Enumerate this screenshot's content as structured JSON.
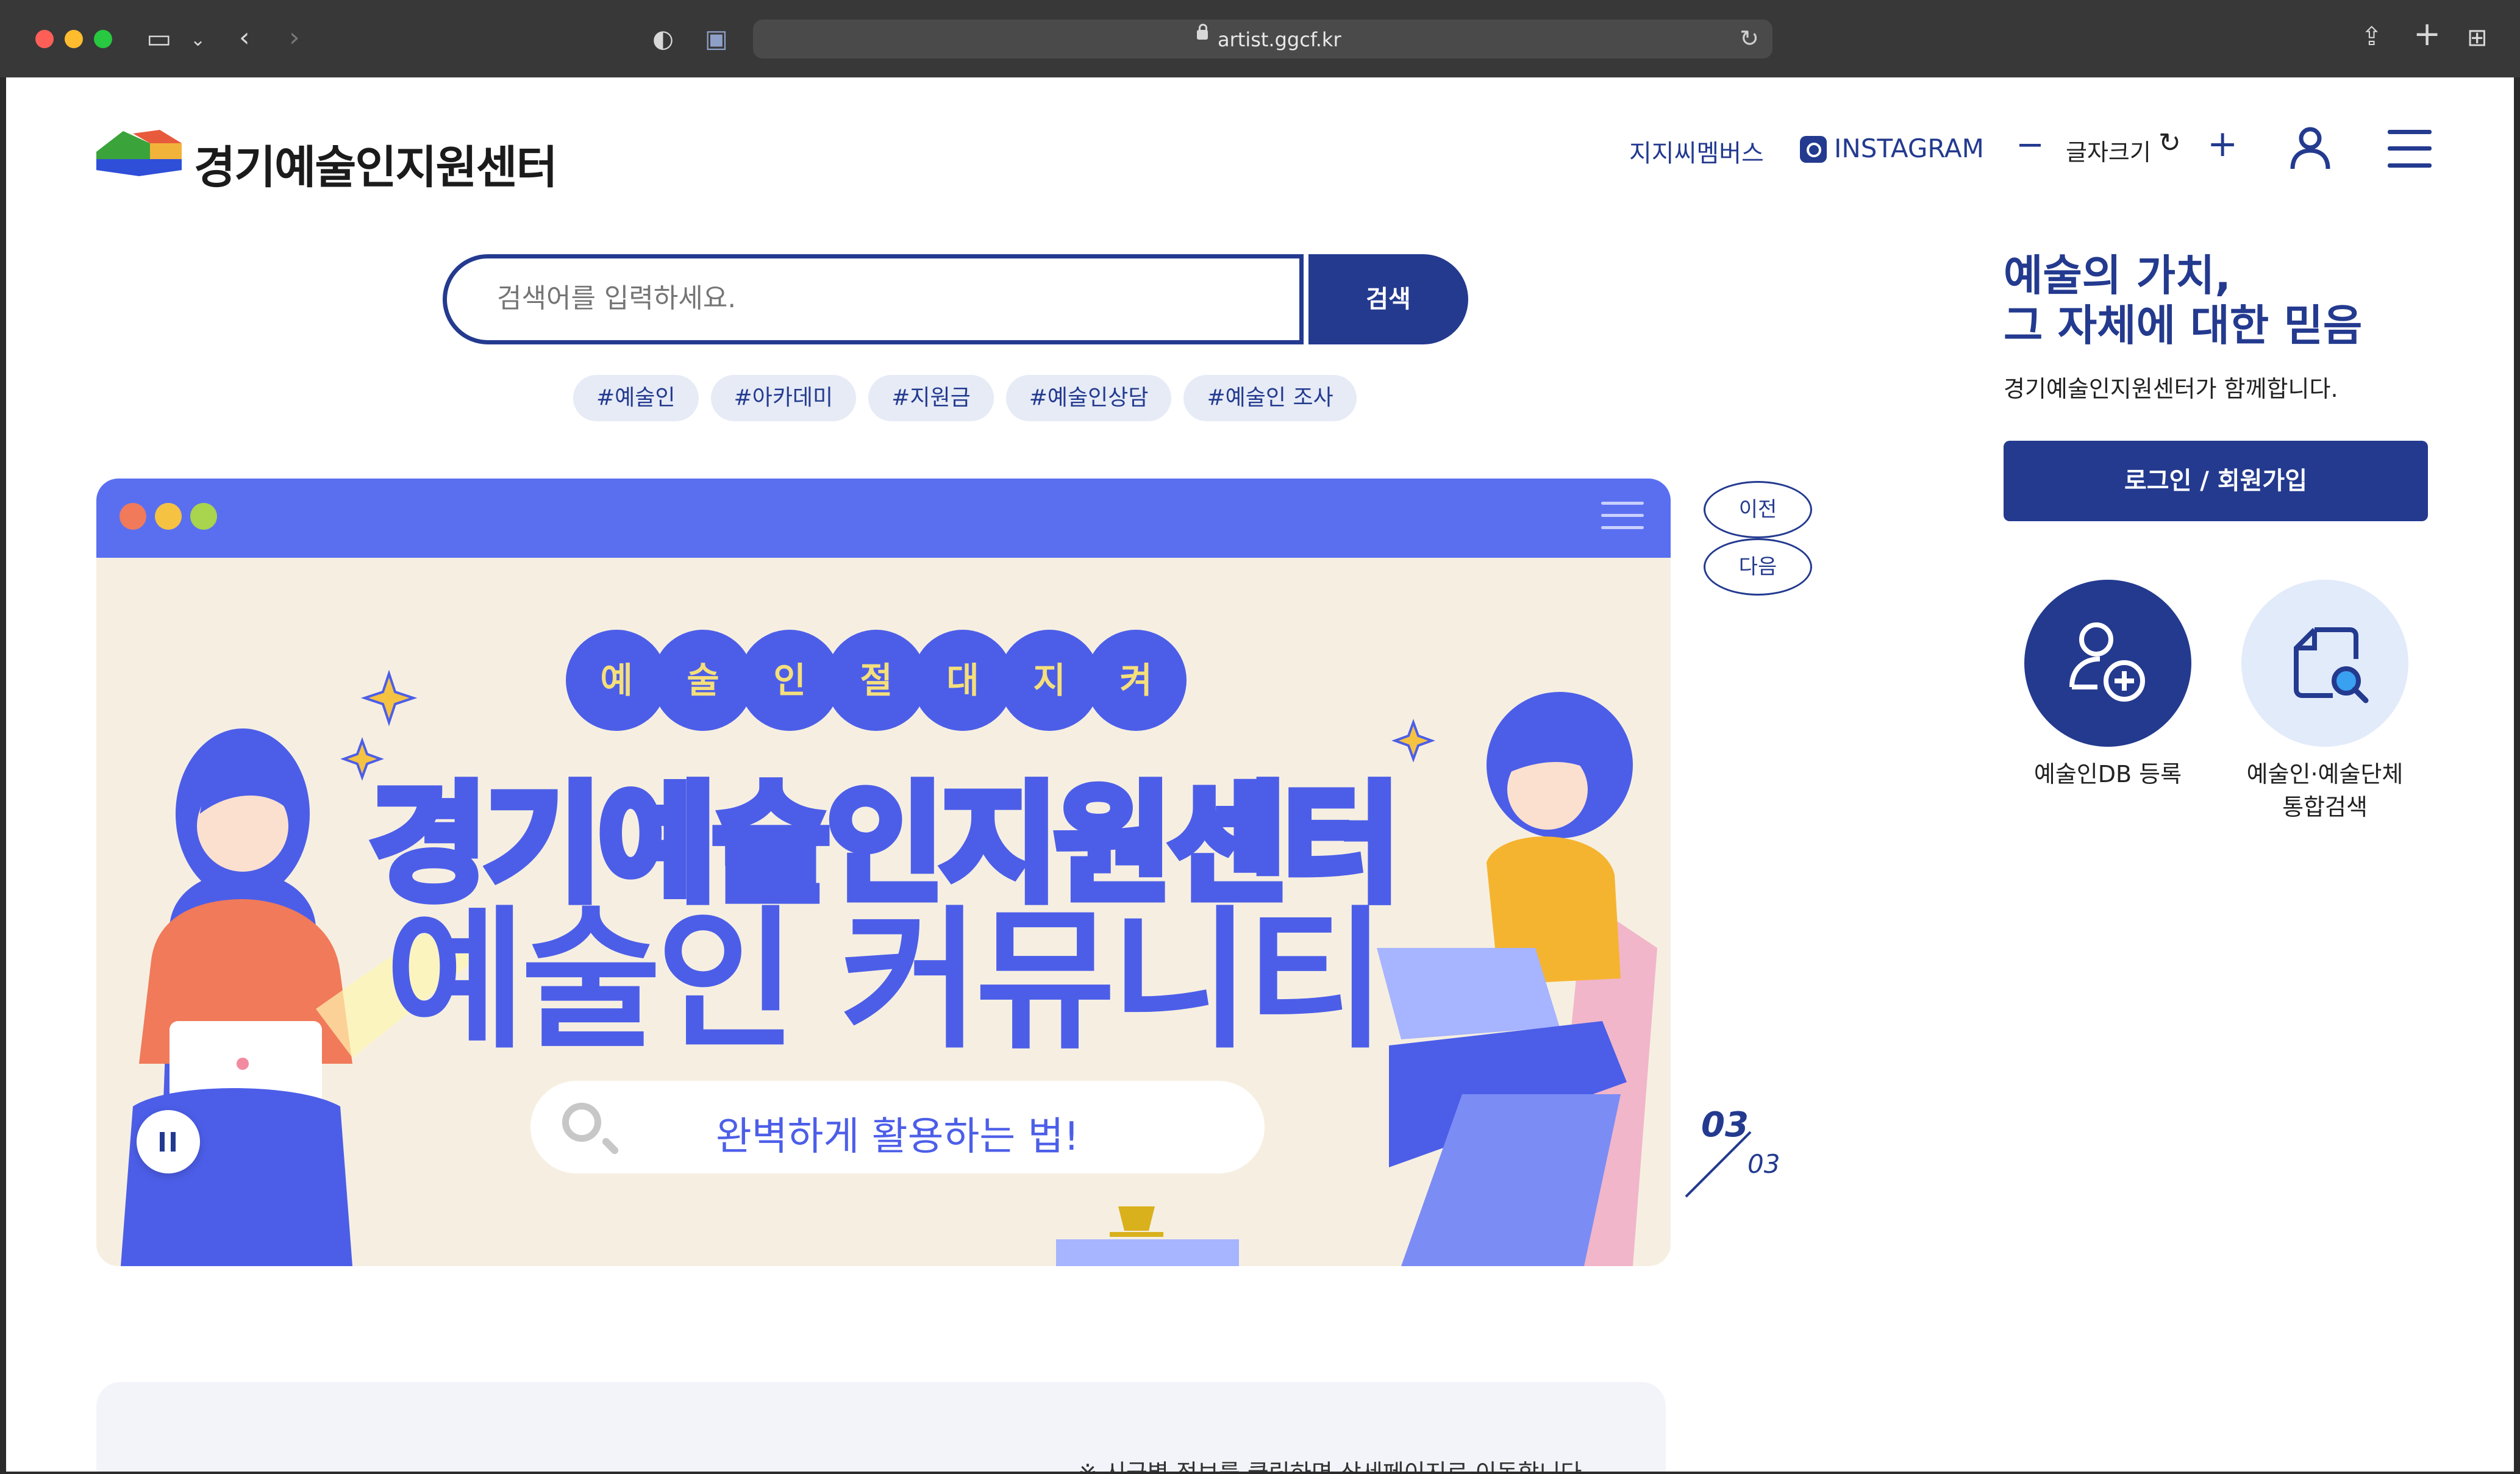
{
  "browser": {
    "url": "artist.ggcf.kr",
    "colors": {
      "close": "#ff5f57",
      "minimize": "#febc2e",
      "zoom": "#28c840"
    }
  },
  "site": {
    "logo_text": "경기예술인지원센터"
  },
  "nav": {
    "member": "지지씨멤버스",
    "instagram": "INSTAGRAM",
    "font_size_label": "글자크기",
    "font_decrease": "−",
    "font_reset": "↻",
    "font_increase": "+",
    "icons": [
      "user-icon",
      "hamburger-menu-icon",
      "instagram-icon"
    ]
  },
  "search": {
    "placeholder": "검색어를 입력하세요.",
    "button_label": "검색",
    "tags": [
      "#예술인",
      "#아카데미",
      "#지원금",
      "#예술인상담",
      "#예술인 조사"
    ]
  },
  "banner": {
    "bubbles": [
      "예",
      "술",
      "인",
      "절",
      "대",
      "지",
      "켜"
    ],
    "title_line1": "경기예술인지원센터",
    "title_line2": "예술인 커뮤니티",
    "pill_text": "완벽하게 활용하는 법!",
    "prev_label": "이전",
    "next_label": "다음",
    "current_page": "03",
    "total_pages": "03",
    "accent": "#4c5ee8"
  },
  "side": {
    "slogan_line1": "예술의 가치,",
    "slogan_line2": "그 자체에 대한 믿음",
    "slogan_sub": "경기예술인지원센터가 함께합니다.",
    "login_label": "로그인 / 회원가입",
    "quick_links": [
      {
        "label": "예술인DB 등록",
        "icon": "user-add-icon"
      },
      {
        "label_line1": "예술인·예술단체",
        "label_line2": "통합검색",
        "icon": "document-search-icon"
      }
    ],
    "brand_color": "#233a8f"
  },
  "bottom": {
    "note": "※ 시군별 정보를 클릭하면 상세페이지로 이동합니다"
  }
}
